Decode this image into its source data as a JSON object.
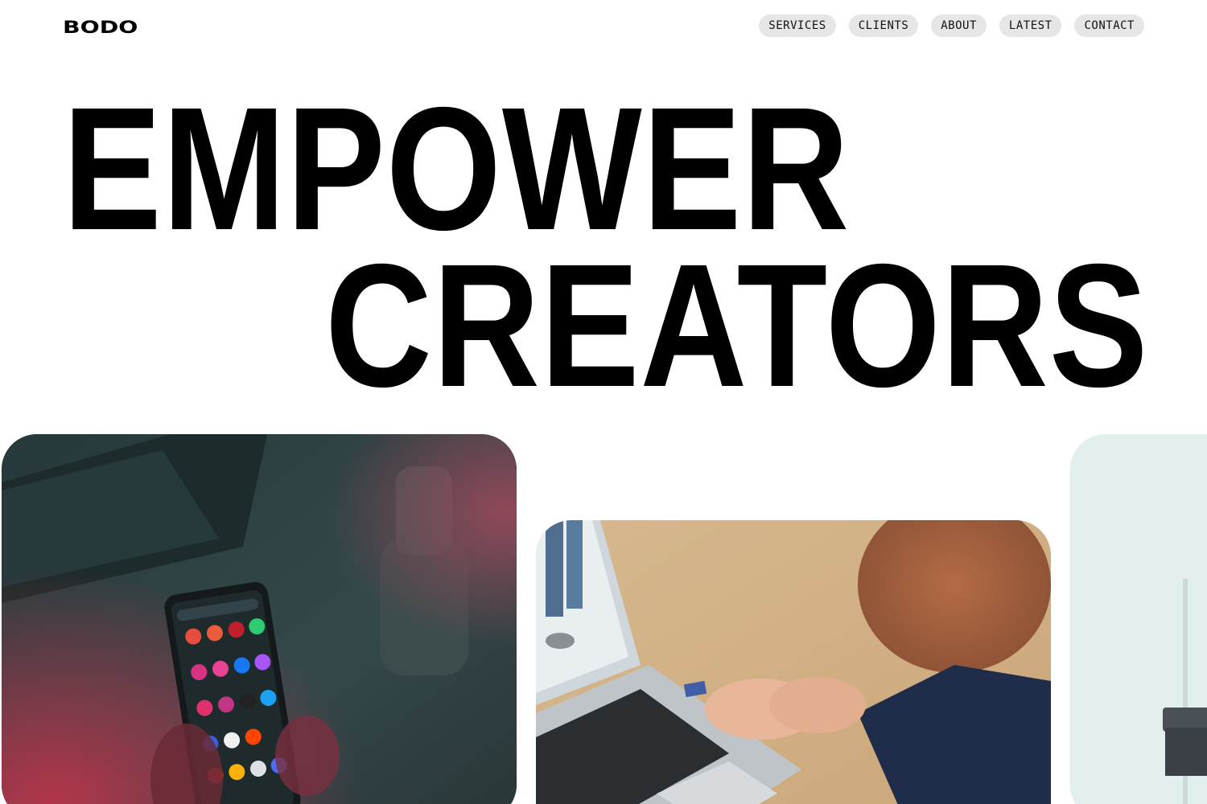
{
  "header": {
    "logo": "BODO",
    "nav": [
      "SERVICES",
      "CLIENTS",
      "ABOUT",
      "LATEST",
      "CONTACT"
    ]
  },
  "hero": {
    "line1": "EMPOWER",
    "line2": "CREATORS"
  },
  "cards": [
    {
      "subject": "hands holding smartphone showing app grid"
    },
    {
      "subject": "person inserting SD card into laptop"
    },
    {
      "subject": "partial bright room with laptop"
    }
  ],
  "colors": {
    "background": "#ffffff",
    "text": "#000000",
    "nav_pill": "#e6e6e6"
  }
}
